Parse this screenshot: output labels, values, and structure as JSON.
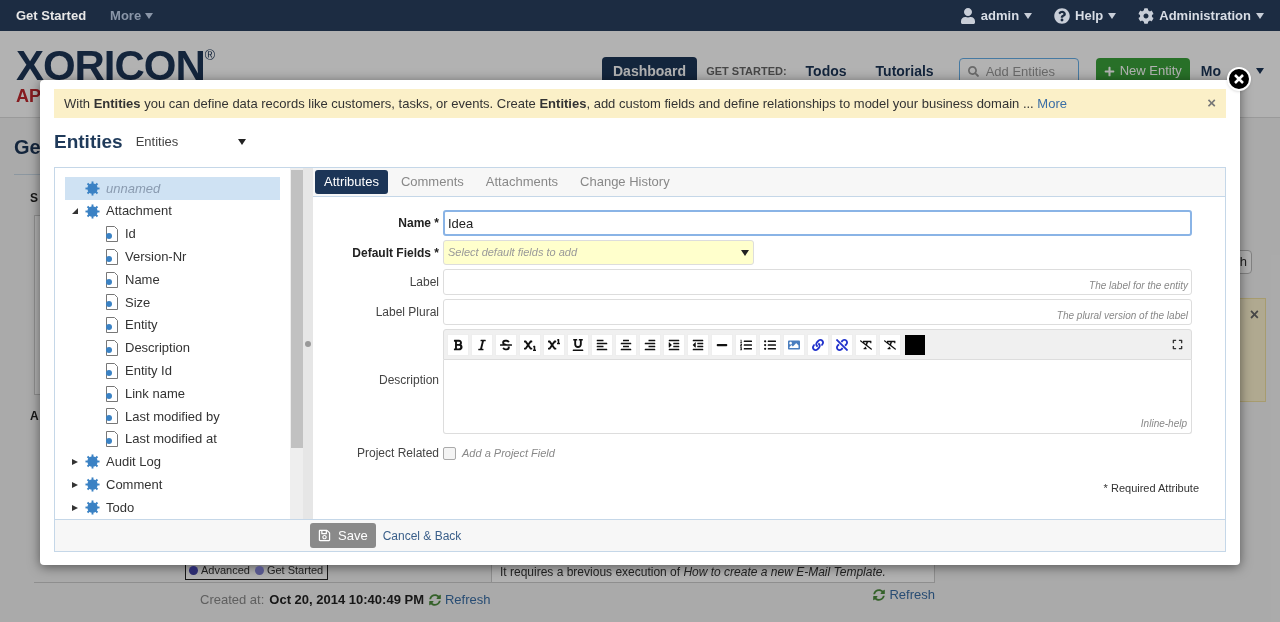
{
  "topbar": {
    "left": [
      {
        "label": "Get Started",
        "selected": true
      },
      {
        "label": "More",
        "selected": false
      }
    ],
    "right": [
      {
        "label": "admin"
      },
      {
        "label": "Help"
      },
      {
        "label": "Administration"
      }
    ]
  },
  "header": {
    "logo": {
      "text": "XORICON",
      "mark": "®",
      "sub": "AP"
    },
    "tabs": [
      {
        "label": "Dashboard",
        "selected": true
      },
      {
        "label": "Todos",
        "selected": false
      },
      {
        "label": "Tutorials",
        "selected": false
      }
    ],
    "get_started_label": "GET STARTED:",
    "search": {
      "placeholder": "Add Entities"
    },
    "new_button": "New Entity",
    "more": "Mo"
  },
  "background": {
    "title": "Ge",
    "section_1": "S",
    "section_2": "A",
    "side_button": "h",
    "panel_close": "×",
    "legend": [
      {
        "label": "Advanced",
        "color": "#2b2b6e"
      },
      {
        "label": "Get Started",
        "color": "#55558a"
      }
    ],
    "created_label": "Created at:",
    "created_value": "Oct 20, 2014 10:40:49 PM",
    "refresh_1": "Refresh",
    "note": "It requires a brevious execution of *How to create a new E-Mail Template.*",
    "refresh_2": "Refresh"
  },
  "modal": {
    "alert": {
      "text": "With **Entities** you can define data records like customers, tasks, or events. Create **Entities**, add custom fields and define relationships to model your business domain ...",
      "link": "More",
      "close": "×"
    },
    "title": "Entities",
    "selector": "Entities",
    "tree": [
      {
        "label": "unnamed",
        "kind": "entity",
        "selected": true,
        "italic": true
      },
      {
        "label": "Attachment",
        "kind": "entity",
        "selected": false,
        "italic": false,
        "expanded": true,
        "children": [
          {
            "label": "Id",
            "kind": "field",
            "selected": false
          },
          {
            "label": "Version-Nr",
            "kind": "field",
            "selected": false
          },
          {
            "label": "Name",
            "kind": "field",
            "selected": false
          },
          {
            "label": "Size",
            "kind": "field",
            "selected": false
          },
          {
            "label": "Entity",
            "kind": "field",
            "selected": false
          },
          {
            "label": "Description",
            "kind": "field",
            "selected": false
          },
          {
            "label": "Entity Id",
            "kind": "field",
            "selected": false
          },
          {
            "label": "Link name",
            "kind": "field",
            "selected": false
          },
          {
            "label": "Last modified by",
            "kind": "field",
            "selected": false
          },
          {
            "label": "Last modified at",
            "kind": "field",
            "selected": false
          }
        ]
      },
      {
        "label": "Audit Log",
        "kind": "entity",
        "selected": false,
        "italic": false,
        "expanded": false
      },
      {
        "label": "Comment",
        "kind": "entity",
        "selected": false,
        "italic": false,
        "expanded": false
      },
      {
        "label": "Todo",
        "kind": "entity",
        "selected": false,
        "italic": false,
        "expanded": false
      }
    ],
    "tabs": [
      {
        "label": "Attributes",
        "selected": true
      },
      {
        "label": "Comments",
        "selected": false
      },
      {
        "label": "Attachments",
        "selected": false
      },
      {
        "label": "Change History",
        "selected": false
      }
    ],
    "form": {
      "name": {
        "label": "Name *",
        "value": "Idea"
      },
      "default_fields": {
        "label": "Default Fields *",
        "placeholder": "Select default fields to add"
      },
      "label": {
        "label": "Label",
        "help": "The label for the entity"
      },
      "label_plural": {
        "label": "Label Plural",
        "help": "The plural version of the label"
      },
      "description": {
        "label": "Description",
        "help": "Inline-help"
      },
      "project_related": {
        "label": "Project Related",
        "checked": false,
        "hint": "Add a Project Field"
      },
      "required_note": "* Required Attribute"
    },
    "footer": {
      "save": "Save",
      "cancel": "Cancel & Back"
    }
  }
}
